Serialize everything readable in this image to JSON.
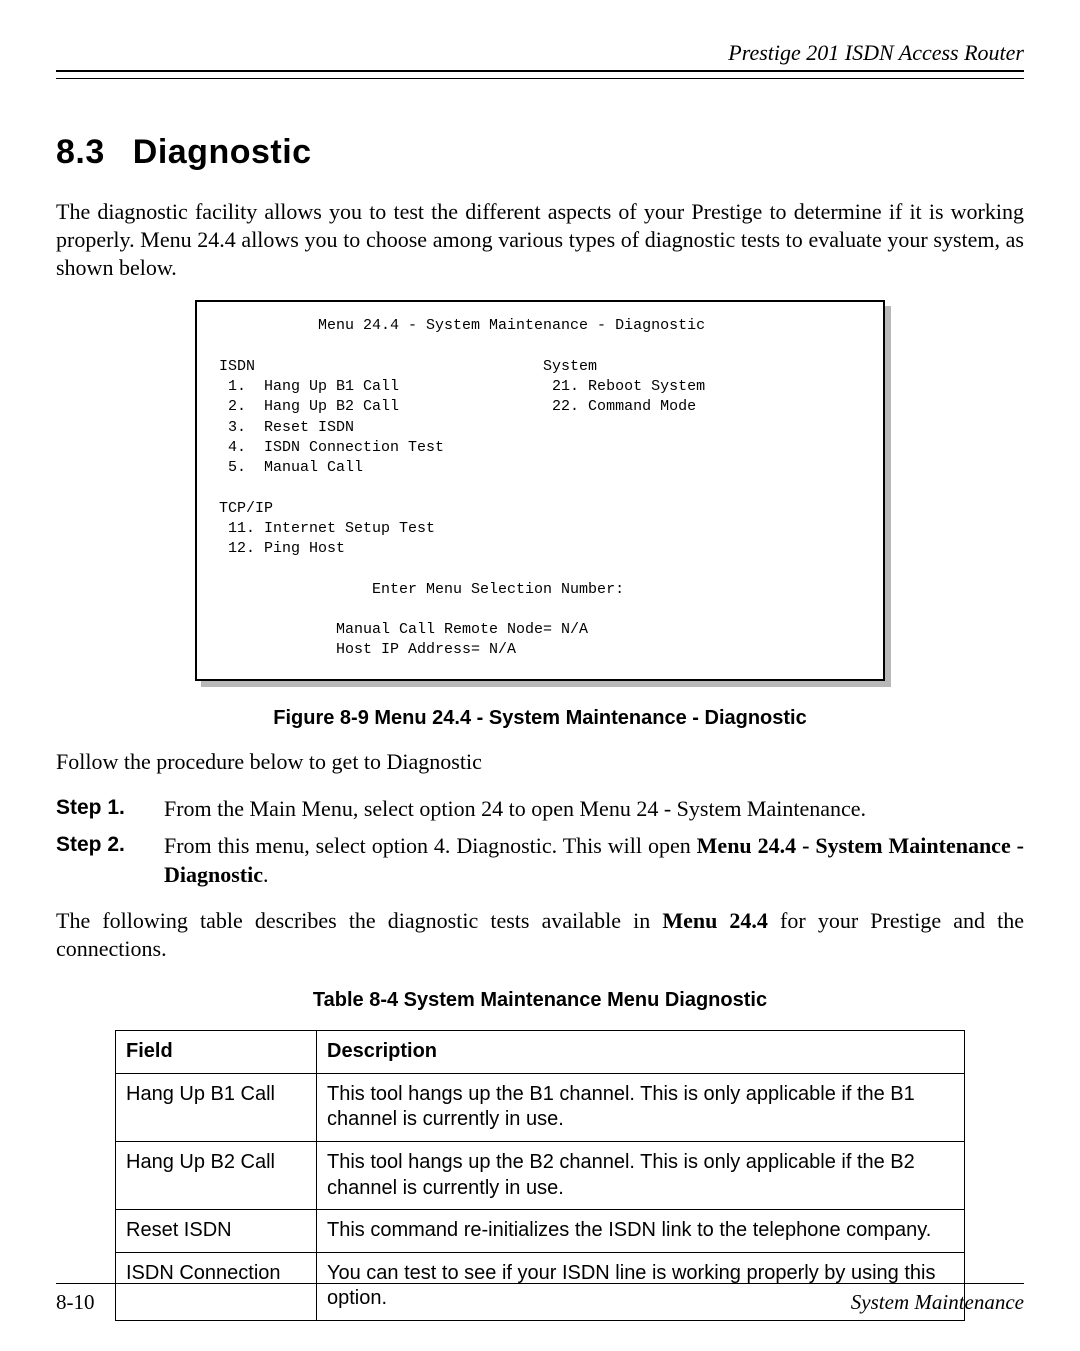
{
  "header": {
    "running_title": "Prestige 201 ISDN Access Router"
  },
  "section": {
    "number": "8.3",
    "title": "Diagnostic"
  },
  "intro_paragraph": "The diagnostic facility allows you to test the different aspects of your Prestige to determine if it is working properly. Menu 24.4 allows you to choose among various types of diagnostic tests to evaluate your system, as shown below.",
  "terminal": {
    "title_line": "Menu 24.4 - System Maintenance - Diagnostic",
    "col_left_header": "ISDN",
    "col_right_header": "System",
    "isdn_items": {
      "i1": "1.  Hang Up B1 Call",
      "i2": "2.  Hang Up B2 Call",
      "i3": "3.  Reset ISDN",
      "i4": "4.  ISDN Connection Test",
      "i5": "5.  Manual Call"
    },
    "system_items": {
      "s21": "21. Reboot System",
      "s22": "22. Command Mode"
    },
    "tcpip_header": "TCP/IP",
    "tcpip_items": {
      "t11": "11. Internet Setup Test",
      "t12": "12. Ping Host"
    },
    "prompt": "Enter Menu Selection Number:",
    "manual_call_line": "Manual Call Remote Node= N/A",
    "host_ip_line": "Host IP Address= N/A"
  },
  "figure_caption": "Figure 8-9 Menu 24.4 - System Maintenance - Diagnostic",
  "follow_text": "Follow the procedure below to get to Diagnostic",
  "steps": {
    "s1_label": "Step 1.",
    "s1_text": "From the Main Menu, select option 24 to open Menu 24 - System Maintenance.",
    "s2_label": "Step 2.",
    "s2_text_a": "From this menu, select option 4. Diagnostic. This will open ",
    "s2_text_bold": "Menu 24.4 - System Maintenance - Diagnostic",
    "s2_text_b": "."
  },
  "after_steps_a": "The following table describes the diagnostic tests available in ",
  "after_steps_bold": "Menu 24.4",
  "after_steps_b": " for your Prestige and the connections.",
  "table_caption": "Table 8-4 System Maintenance Menu Diagnostic",
  "table": {
    "head_field": "Field",
    "head_desc": "Description",
    "rows": [
      {
        "field": "Hang Up B1 Call",
        "desc": "This tool hangs up the B1 channel. This is only applicable if the B1 channel is currently in use."
      },
      {
        "field": "Hang Up B2 Call",
        "desc": "This tool hangs up the B2 channel. This is only applicable if the B2 channel is currently in use."
      },
      {
        "field": "Reset ISDN",
        "desc": "This command re-initializes the ISDN link to the telephone company."
      },
      {
        "field": "ISDN Connection",
        "desc": "You can test to see if your ISDN line is working properly by using this option."
      }
    ]
  },
  "footer": {
    "page_number": "8-10",
    "chapter": "System Maintenance"
  }
}
